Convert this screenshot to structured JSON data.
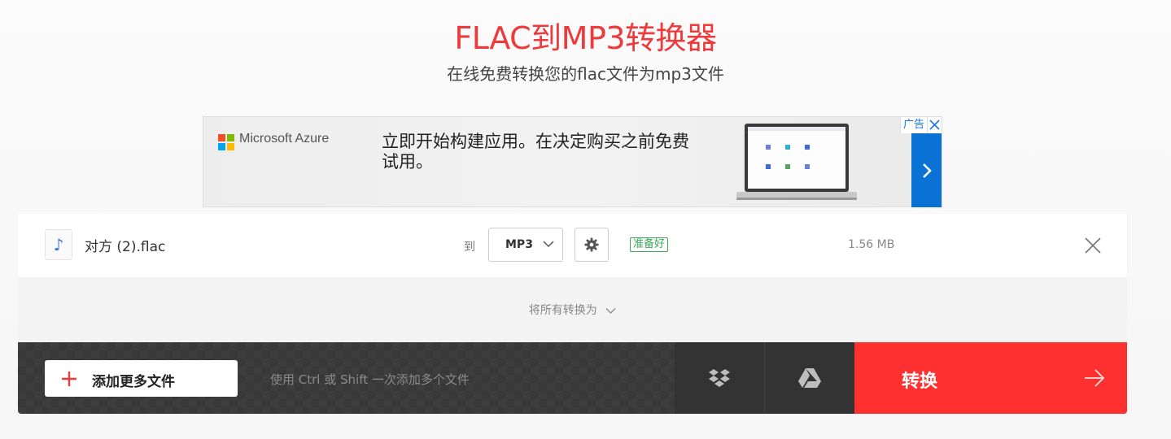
{
  "header": {
    "title": "FLAC到MP3转换器",
    "subtitle": "在线免费转换您的flac文件为mp3文件"
  },
  "ad": {
    "brand": "Microsoft Azure",
    "text": "立即开始构建应用。在决定购买之前免费试用。",
    "badge_label": "广告",
    "arrow_icon": "chevron-right-icon",
    "colors": {
      "arrow_bg": "#0a72d4"
    }
  },
  "file": {
    "name": "对方 (2).flac",
    "to_label": "到",
    "format": "MP3",
    "status": "准备好",
    "size": "1.56 MB"
  },
  "convert_all": {
    "label": "将所有转换为"
  },
  "bottom_bar": {
    "add_files_label": "添加更多文件",
    "hint": "使用 Ctrl 或 Shift 一次添加多个文件",
    "convert_label": "转换"
  },
  "colors": {
    "accent": "#ee3a3a",
    "convert_bg": "#ff3030",
    "status_green": "#3aa757"
  }
}
